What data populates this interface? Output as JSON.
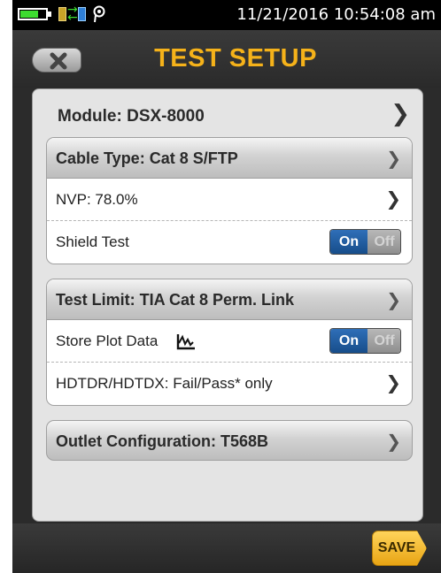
{
  "status_bar": {
    "datetime": "11/21/2016 10:54:08 am",
    "battery_level": 0.7,
    "icons": [
      "battery-icon",
      "link-status-icon",
      "location-pin-icon"
    ]
  },
  "header": {
    "title": "TEST SETUP",
    "back_icon": "close-x-icon"
  },
  "module": {
    "label": "Module: DSX-8000"
  },
  "cable_group": {
    "header": "Cable Type: Cat 8 S/FTP",
    "rows": [
      {
        "label": "NVP: 78.0%"
      },
      {
        "label": "Shield Test",
        "toggle_on": "On",
        "toggle_off": "Off"
      }
    ]
  },
  "limit_group": {
    "header": "Test Limit: TIA Cat 8 Perm. Link",
    "rows": [
      {
        "label": "Store Plot Data",
        "icon": "plot-graph-icon",
        "toggle_on": "On",
        "toggle_off": "Off"
      },
      {
        "label": "HDTDR/HDTDX: Fail/Pass* only"
      }
    ]
  },
  "outlet": {
    "label": "Outlet Configuration: T568B"
  },
  "footer": {
    "save_label": "SAVE"
  },
  "colors": {
    "title": "#f5b21a",
    "toggle_on": "#2f6fb8",
    "save": "#f5b21a"
  }
}
